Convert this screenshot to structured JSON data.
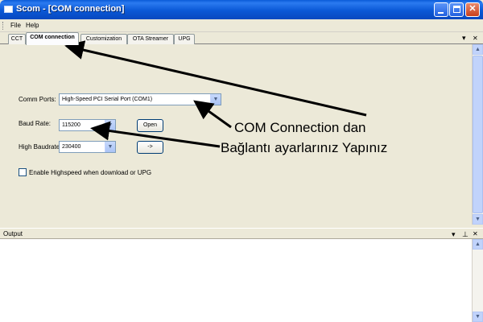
{
  "window": {
    "title": "Scom - [COM connection]"
  },
  "menu": {
    "items": [
      "File",
      "Help"
    ]
  },
  "tabs": {
    "items": [
      "CCT",
      "COM connection",
      "Customization",
      "OTA Streamer",
      "UPG"
    ],
    "active": "COM connection",
    "dropdown_glyph": "▾",
    "close_glyph": "✕"
  },
  "form": {
    "comm_ports_label": "Comm Ports:",
    "comm_ports_value": "High-Speed PCI Serial Port (COM1)",
    "baud_rate_label": "Baud Rate:",
    "baud_rate_value": "115200",
    "open_button": "Open",
    "high_baudrate_label": "High Baudrate:",
    "high_baudrate_value": "230400",
    "arrow_button": "->",
    "highspeed_checkbox_label": "Enable Highspeed when download or UPG",
    "highspeed_checked": false
  },
  "output": {
    "title": "Output",
    "dropdown_glyph": "▾",
    "pin_glyph": "⊥",
    "close_glyph": "✕"
  },
  "annotation": {
    "line1": "COM Connection dan",
    "line2": "Bağlantı ayarlarınız Yapınız"
  },
  "colors": {
    "titlebar": "#0a58d6",
    "annotation_arrow": "#000000"
  }
}
